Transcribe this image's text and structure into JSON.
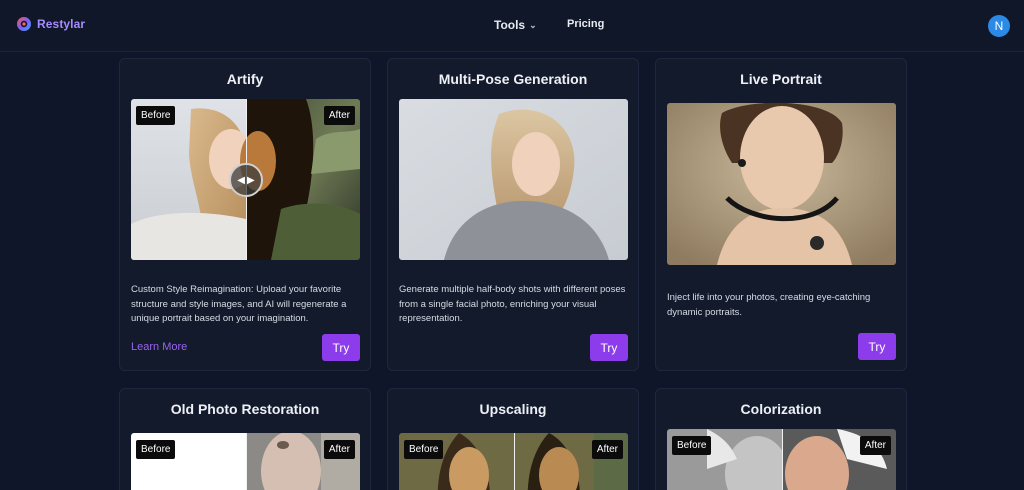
{
  "nav": {
    "brand": "Restylar",
    "tools_label": "Tools",
    "pricing_label": "Pricing",
    "avatar_initial": "N"
  },
  "cards": [
    {
      "title": "Artify",
      "description": "Custom Style Reimagination: Upload your favorite structure and style images, and AI will regenerate a unique portrait based on your imagination.",
      "learn_more": "Learn More",
      "try": "Try",
      "before": "Before",
      "after": "After"
    },
    {
      "title": "Multi-Pose Generation",
      "description": "Generate multiple half-body shots with different poses from a single facial photo, enriching your visual representation.",
      "try": "Try"
    },
    {
      "title": "Live Portrait",
      "description": "Inject life into your photos, creating eye-catching dynamic portraits.",
      "try": "Try"
    },
    {
      "title": "Old Photo Restoration",
      "before": "Before",
      "after": "After"
    },
    {
      "title": "Upscaling",
      "before": "Before",
      "after": "After"
    },
    {
      "title": "Colorization",
      "before": "Before",
      "after": "After"
    }
  ],
  "colors": {
    "background": "#0f1629",
    "card": "#121a2c",
    "accent": "#8d3ceb",
    "link": "#9b63f2",
    "avatar": "#2a8ae6"
  }
}
